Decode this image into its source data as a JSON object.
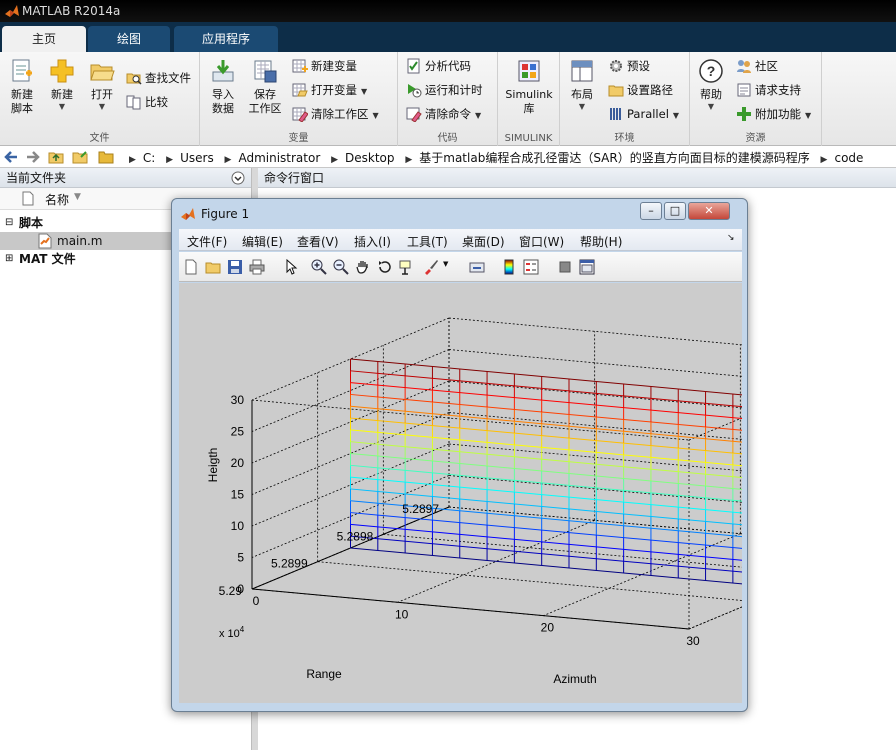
{
  "app": {
    "title": "MATLAB R2014a"
  },
  "tabs": [
    {
      "label": "主页",
      "active": true
    },
    {
      "label": "绘图",
      "active": false
    },
    {
      "label": "应用程序",
      "active": false
    }
  ],
  "ribbon": {
    "file_group": {
      "name": "文件",
      "new_script": "新建\n脚本",
      "new": "新建",
      "open": "打开",
      "find_files": "查找文件",
      "compare": "比较"
    },
    "variable_group": {
      "name": "变量",
      "import_data": "导入\n数据",
      "save_workspace": "保存\n工作区",
      "new_variable": "新建变量",
      "open_variable": "打开变量",
      "clear_workspace": "清除工作区"
    },
    "code_group": {
      "name": "代码",
      "analyze_code": "分析代码",
      "run_and_time": "运行和计时",
      "clear_commands": "清除命令"
    },
    "simulink_group": {
      "name": "SIMULINK",
      "simulink_library": "Simulink\n库"
    },
    "environment_group": {
      "name": "环境",
      "layout": "布局",
      "preferences": "预设",
      "set_path": "设置路径",
      "parallel": "Parallel"
    },
    "resources_group": {
      "name": "资源",
      "help": "帮助",
      "community": "社区",
      "request_support": "请求支持",
      "add_ons": "附加功能"
    }
  },
  "address": {
    "crumbs": [
      "C:",
      "Users",
      "Administrator",
      "Desktop",
      "基于matlab编程合成孔径雷达（SAR）的竖直方向面目标的建模源码程序",
      "code"
    ]
  },
  "current_folder": {
    "title": "当前文件夹",
    "column_name": "名称",
    "groups": [
      {
        "label": "脚本",
        "expanded": true,
        "items": [
          "main.m"
        ]
      },
      {
        "label": "MAT 文件",
        "expanded": false,
        "items": []
      }
    ]
  },
  "command_window": {
    "title": "命令行窗口"
  },
  "figure": {
    "title": "Figure 1",
    "menu": [
      "文件(F)",
      "编辑(E)",
      "查看(V)",
      "插入(I)",
      "工具(T)",
      "桌面(D)",
      "窗口(W)",
      "帮助(H)"
    ],
    "toolbar_icons": [
      "new-figure-icon",
      "open-file-icon",
      "save-icon",
      "print-icon",
      "pointer-icon",
      "zoom-in-icon",
      "zoom-out-icon",
      "pan-icon",
      "rotate-3d-icon",
      "data-cursor-icon",
      "brush-icon",
      "link-plot-icon",
      "colorbar-icon",
      "legend-icon",
      "hide-plot-tools-icon",
      "show-plot-tools-icon"
    ]
  },
  "chart_data": {
    "type": "surface-mesh",
    "title": "",
    "xlabel": "Azimuth",
    "ylabel": "Range",
    "zlabel": "Heigth",
    "x_ticks": [
      "0",
      "10",
      "20",
      "30"
    ],
    "y_ticks": [
      "5.2897",
      "5.2898",
      "5.2899",
      "5.29"
    ],
    "y_multiplier": "x 10^4",
    "z_ticks": [
      "0",
      "5",
      "10",
      "15",
      "20",
      "25",
      "30"
    ],
    "xlim": [
      0,
      30
    ],
    "ylim": [
      52897,
      52900
    ],
    "zlim": [
      0,
      30
    ],
    "grid": true,
    "surface": {
      "description_plane": "vertical plane at constant range",
      "x_range": [
        0,
        30
      ],
      "y_value": 52898.5,
      "z_range": [
        0,
        30
      ],
      "columns": 16,
      "rows": 16,
      "colormap": "jet by height"
    }
  }
}
